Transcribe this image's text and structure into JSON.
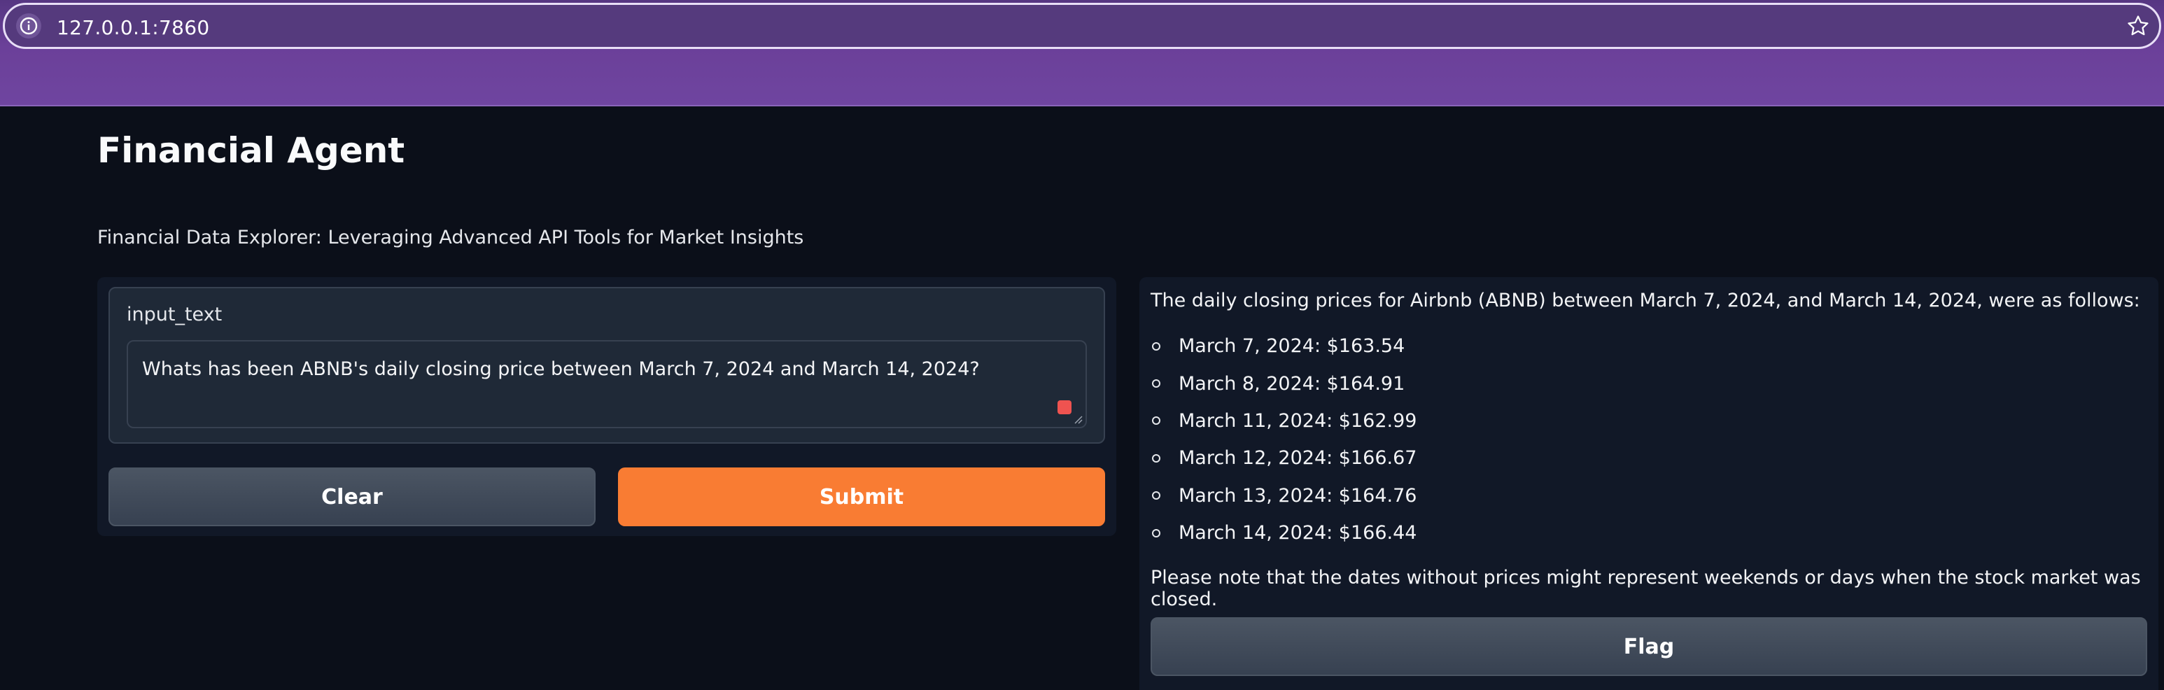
{
  "browser": {
    "url": "127.0.0.1:7860",
    "colors": {
      "bar": "#553a7d",
      "chrome": "#6f45a0"
    }
  },
  "page": {
    "title": "Financial Agent",
    "subtitle": "Financial Data Explorer: Leveraging Advanced API Tools for Market Insights"
  },
  "input": {
    "label": "input_text",
    "value": "Whats has been ABNB's daily closing price between March 7, 2024 and March 14, 2024?"
  },
  "buttons": {
    "clear": "Clear",
    "submit": "Submit",
    "flag": "Flag",
    "submit_color": "#f97c33"
  },
  "output": {
    "intro": "The daily closing prices for Airbnb (ABNB) between March 7, 2024, and March 14, 2024, were as follows:",
    "items": [
      "March 7, 2024: $163.54",
      "March 8, 2024: $164.91",
      "March 11, 2024: $162.99",
      "March 12, 2024: $166.67",
      "March 13, 2024: $164.76",
      "March 14, 2024: $166.44"
    ],
    "note": "Please note that the dates without prices might represent weekends or days when the stock market was closed."
  },
  "icons": {
    "info": "info-icon",
    "bookmark": "star-icon"
  }
}
